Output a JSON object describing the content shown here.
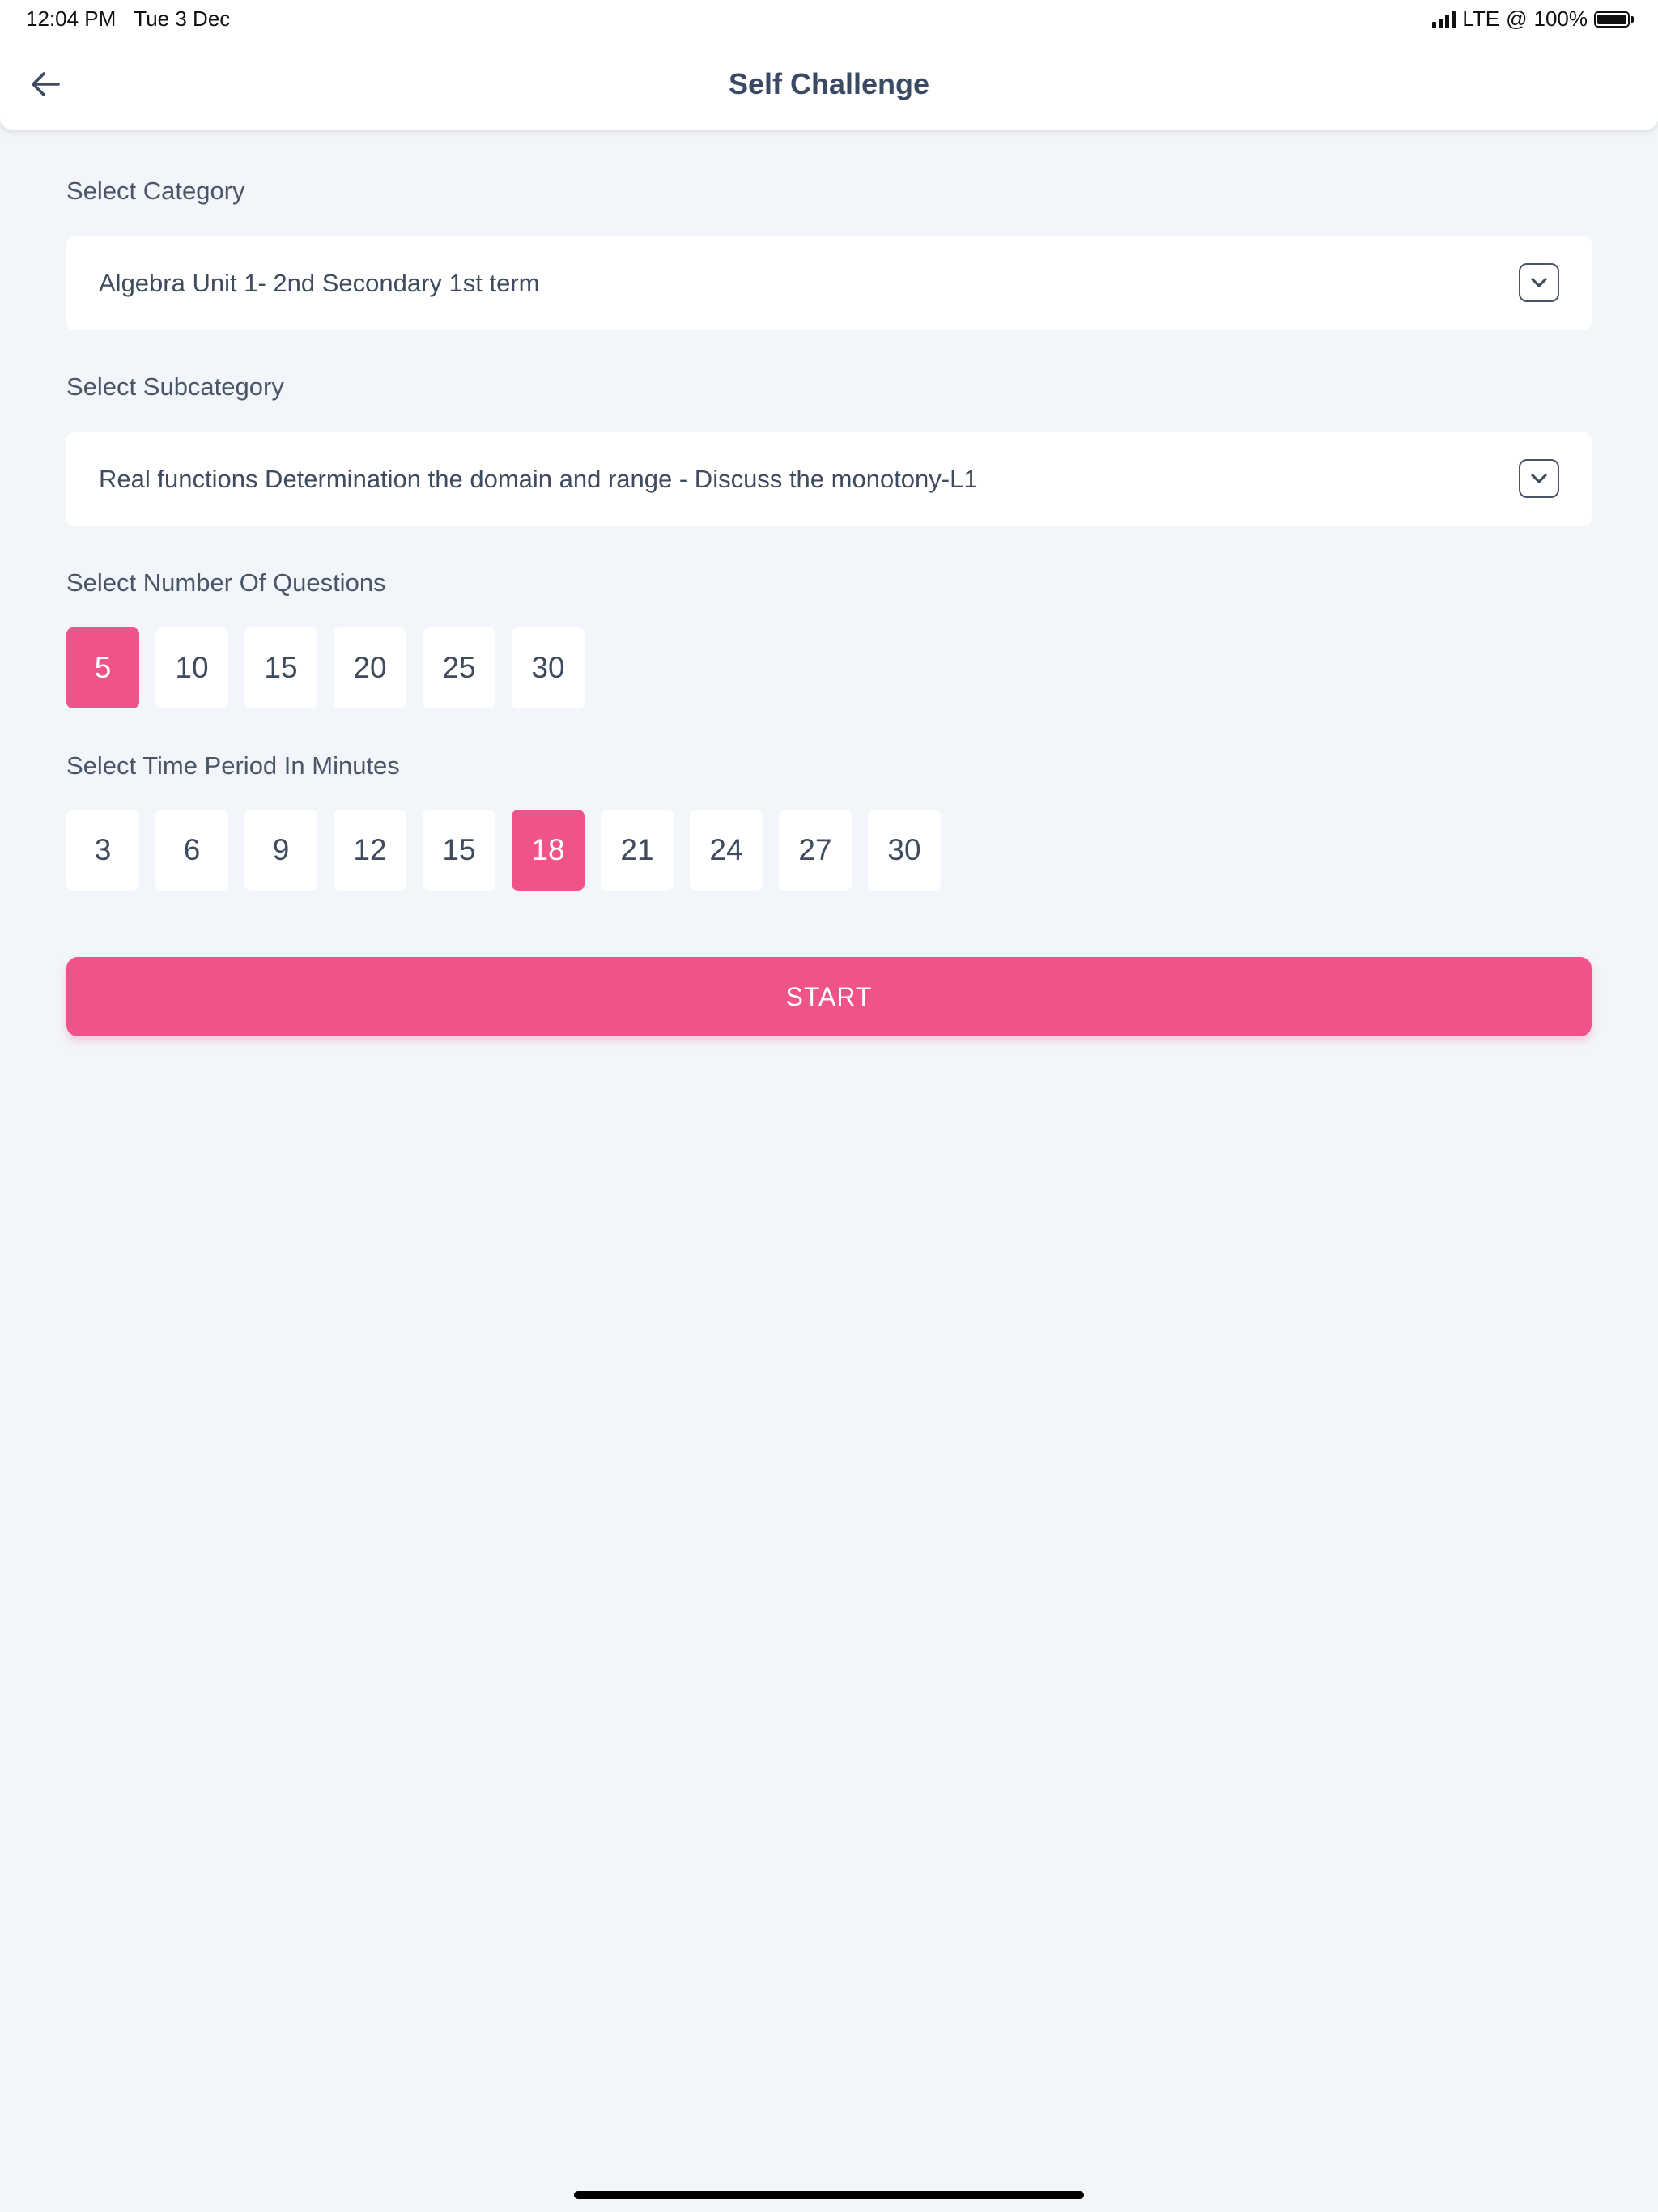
{
  "status_bar": {
    "time": "12:04 PM",
    "date": "Tue 3 Dec",
    "network": "LTE",
    "location_glyph": "@",
    "battery": "100%",
    "battery_level": 1.0,
    "signal_bars": 4
  },
  "header": {
    "title": "Self Challenge",
    "back_icon": "arrow-left-icon"
  },
  "category": {
    "label": "Select Category",
    "value": "Algebra Unit 1- 2nd Secondary 1st term",
    "icon": "chevron-down-icon"
  },
  "subcategory": {
    "label": "Select Subcategory",
    "value": "Real functions Determination the domain and range - Discuss the monotony-L1",
    "icon": "chevron-down-icon"
  },
  "questions": {
    "label": "Select Number Of Questions",
    "options": [
      "5",
      "10",
      "15",
      "20",
      "25",
      "30"
    ],
    "selected_index": 0
  },
  "time_period": {
    "label": "Select Time Period In Minutes",
    "options": [
      "3",
      "6",
      "9",
      "12",
      "15",
      "18",
      "21",
      "24",
      "27",
      "30"
    ],
    "selected_index": 5
  },
  "start_button": {
    "label": "START"
  },
  "colors": {
    "accent": "#f0538a",
    "background": "#f2f5f9",
    "text": "#3f4b5e"
  }
}
